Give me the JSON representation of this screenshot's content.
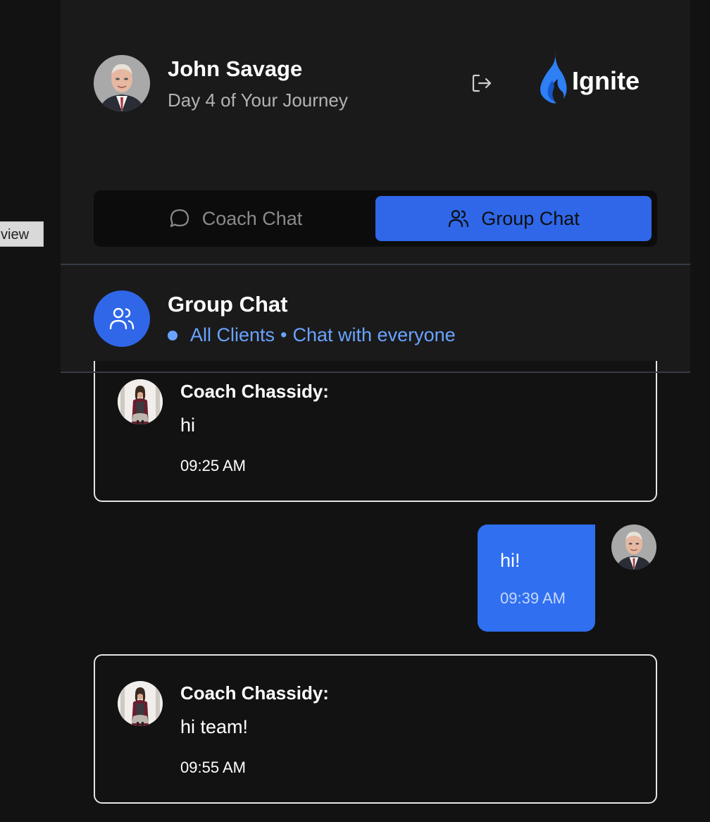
{
  "side_tab": {
    "label": "view"
  },
  "user": {
    "name": "John Savage",
    "subtitle": "Day 4 of Your Journey",
    "avatar": "user-photo"
  },
  "header": {
    "logout_icon": "logout-icon",
    "logo_text": "Ignite",
    "logo_icon": "flame-icon",
    "brand_color": "#2f6ff0"
  },
  "tabs": [
    {
      "label": "Coach Chat",
      "icon": "chat-bubble-icon",
      "active": false
    },
    {
      "label": "Group Chat",
      "icon": "users-icon",
      "active": true
    }
  ],
  "chat": {
    "title": "Group Chat",
    "audience": "All Clients",
    "separator": "•",
    "description": "Chat with everyone",
    "status_color": "#6aa3ff"
  },
  "messages": [
    {
      "sender": "Coach Chassidy:",
      "text": "hi",
      "time": "09:25 AM",
      "own": false
    },
    {
      "sender": "John Savage",
      "text": "hi!",
      "time": "09:39 AM",
      "own": true
    },
    {
      "sender": "Coach Chassidy:",
      "text": "hi team!",
      "time": "09:55 AM",
      "own": false
    }
  ]
}
